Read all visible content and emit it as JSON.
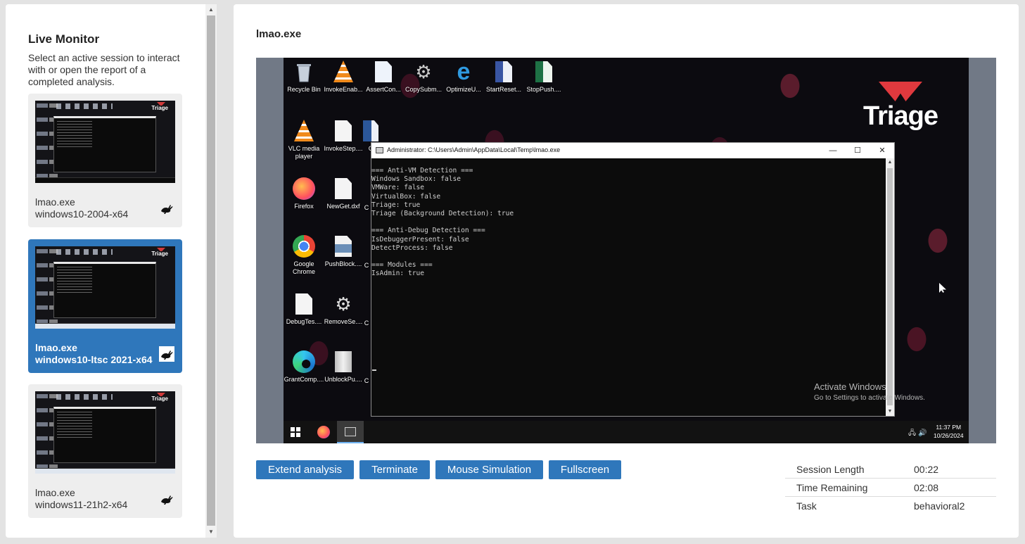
{
  "sidebar": {
    "title": "Live Monitor",
    "description": "Select an active session to interact with or open the report of a completed analysis.",
    "sessions": [
      {
        "file": "lmao.exe",
        "os": "windows10-2004-x64",
        "active": false
      },
      {
        "file": "lmao.exe",
        "os": "windows10-ltsc 2021-x64",
        "active": true
      },
      {
        "file": "lmao.exe",
        "os": "windows11-21h2-x64",
        "active": false
      }
    ],
    "thumb_logo": "Triage"
  },
  "main": {
    "title": "lmao.exe",
    "desktop": {
      "icons": [
        {
          "label": "Recycle Bin",
          "icon": "recycle-bin-icon"
        },
        {
          "label": "InvokeEnab...",
          "icon": "vlc-icon"
        },
        {
          "label": "AssertCon...",
          "icon": "media-file-icon"
        },
        {
          "label": "CopySubm...",
          "icon": "settings-file-icon"
        },
        {
          "label": "OptimizeU...",
          "icon": "internet-explorer-icon"
        },
        {
          "label": "StartReset...",
          "icon": "visio-file-icon"
        },
        {
          "label": "StopPush....",
          "icon": "excel-file-icon"
        },
        {
          "label": "VLC media player",
          "icon": "vlc-icon"
        },
        {
          "label": "InvokeStep....",
          "icon": "document-icon"
        },
        {
          "label": "C",
          "icon": "word-file-icon"
        },
        {
          "label": "Firefox",
          "icon": "firefox-icon"
        },
        {
          "label": "NewGet.dxf",
          "icon": "document-icon"
        },
        {
          "label": "C",
          "icon": "partial-icon"
        },
        {
          "label": "Google Chrome",
          "icon": "chrome-icon"
        },
        {
          "label": "PushBlock....",
          "icon": "image-file-icon"
        },
        {
          "label": "C",
          "icon": "partial-icon"
        },
        {
          "label": "DebugTes....",
          "icon": "document-icon"
        },
        {
          "label": "RemoveSe....",
          "icon": "settings-file-icon"
        },
        {
          "label": "C",
          "icon": "partial-icon"
        },
        {
          "label": "GrantComp....",
          "icon": "edge-icon"
        },
        {
          "label": "UnblockPu....",
          "icon": "archive-icon"
        },
        {
          "label": "C",
          "icon": "partial-icon"
        }
      ],
      "brand": "Triage",
      "console": {
        "title": "Administrator: C:\\Users\\Admin\\AppData\\Local\\Temp\\lmao.exe",
        "output": "=== Anti-VM Detection ===\nWindows Sandbox: false\nVMWare: false\nVirtualBox: false\nTriage: true\nTriage (Background Detection): true\n\n=== Anti-Debug Detection ===\nIsDebuggerPresent: false\nDetectProcess: false\n\n=== Modules ===\nIsAdmin: true",
        "minimize": "—",
        "maximize": "☐",
        "close": "✕"
      },
      "activate_title": "Activate Windows",
      "activate_sub": "Go to Settings to activate Windows.",
      "clock_time": "11:37 PM",
      "clock_date": "10/26/2024"
    },
    "buttons": {
      "extend": "Extend analysis",
      "terminate": "Terminate",
      "mouse_sim": "Mouse Simulation",
      "fullscreen": "Fullscreen"
    },
    "info": [
      {
        "key": "Session Length",
        "value": "00:22"
      },
      {
        "key": "Time Remaining",
        "value": "02:08"
      },
      {
        "key": "Task",
        "value": "behavioral2"
      }
    ]
  },
  "colors": {
    "accent": "#2f77bb",
    "page_bg": "#e3e3e3",
    "console_bg": "#0c0c0c",
    "triage_red": "#e0393e"
  }
}
